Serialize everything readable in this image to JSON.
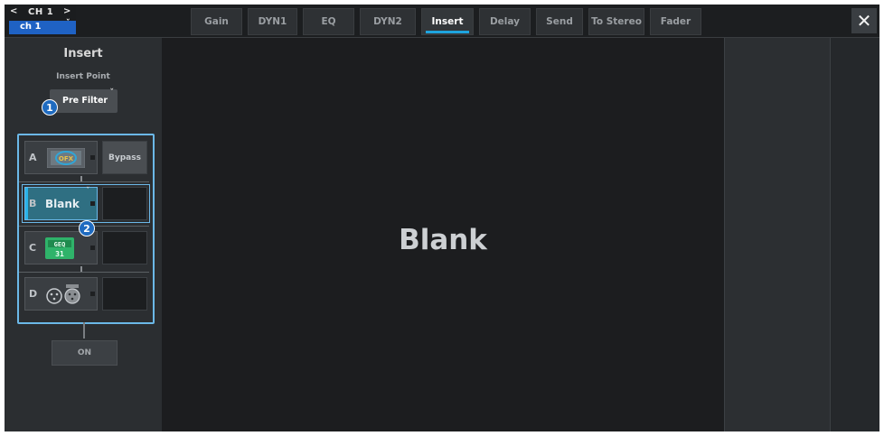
{
  "channel": {
    "number": "CH 1",
    "name": "ch 1",
    "prev_icon": "chevron-left-icon",
    "next_icon": "chevron-right-icon"
  },
  "tabs": [
    {
      "label": "Gain",
      "active": false
    },
    {
      "label": "DYN1",
      "active": false
    },
    {
      "label": "EQ",
      "active": false
    },
    {
      "label": "DYN2",
      "active": false
    },
    {
      "label": "Insert",
      "active": true
    },
    {
      "label": "Delay",
      "active": false
    },
    {
      "label": "Send",
      "active": false
    },
    {
      "label": "To Stereo",
      "active": false
    },
    {
      "label": "Fader",
      "active": false
    }
  ],
  "close_icon": "close-icon",
  "insert": {
    "title": "Insert",
    "insert_point_label": "Insert Point",
    "insert_point_value": "Pre Filter",
    "slots": [
      {
        "letter": "A",
        "content": "rack-device-icon",
        "side": "Bypass"
      },
      {
        "letter": "B",
        "content": "Blank",
        "side": ""
      },
      {
        "letter": "C",
        "content": "geq-31-icon",
        "side": ""
      },
      {
        "letter": "D",
        "content": "connector-icon",
        "side": ""
      }
    ],
    "on_label": "ON"
  },
  "callouts": [
    "1",
    "2"
  ],
  "main_display": "Blank",
  "colors": {
    "accent": "#1ea4de",
    "selection": "#6bb8e8",
    "channel": "#1f62c4",
    "background": "#1c1d1f"
  }
}
